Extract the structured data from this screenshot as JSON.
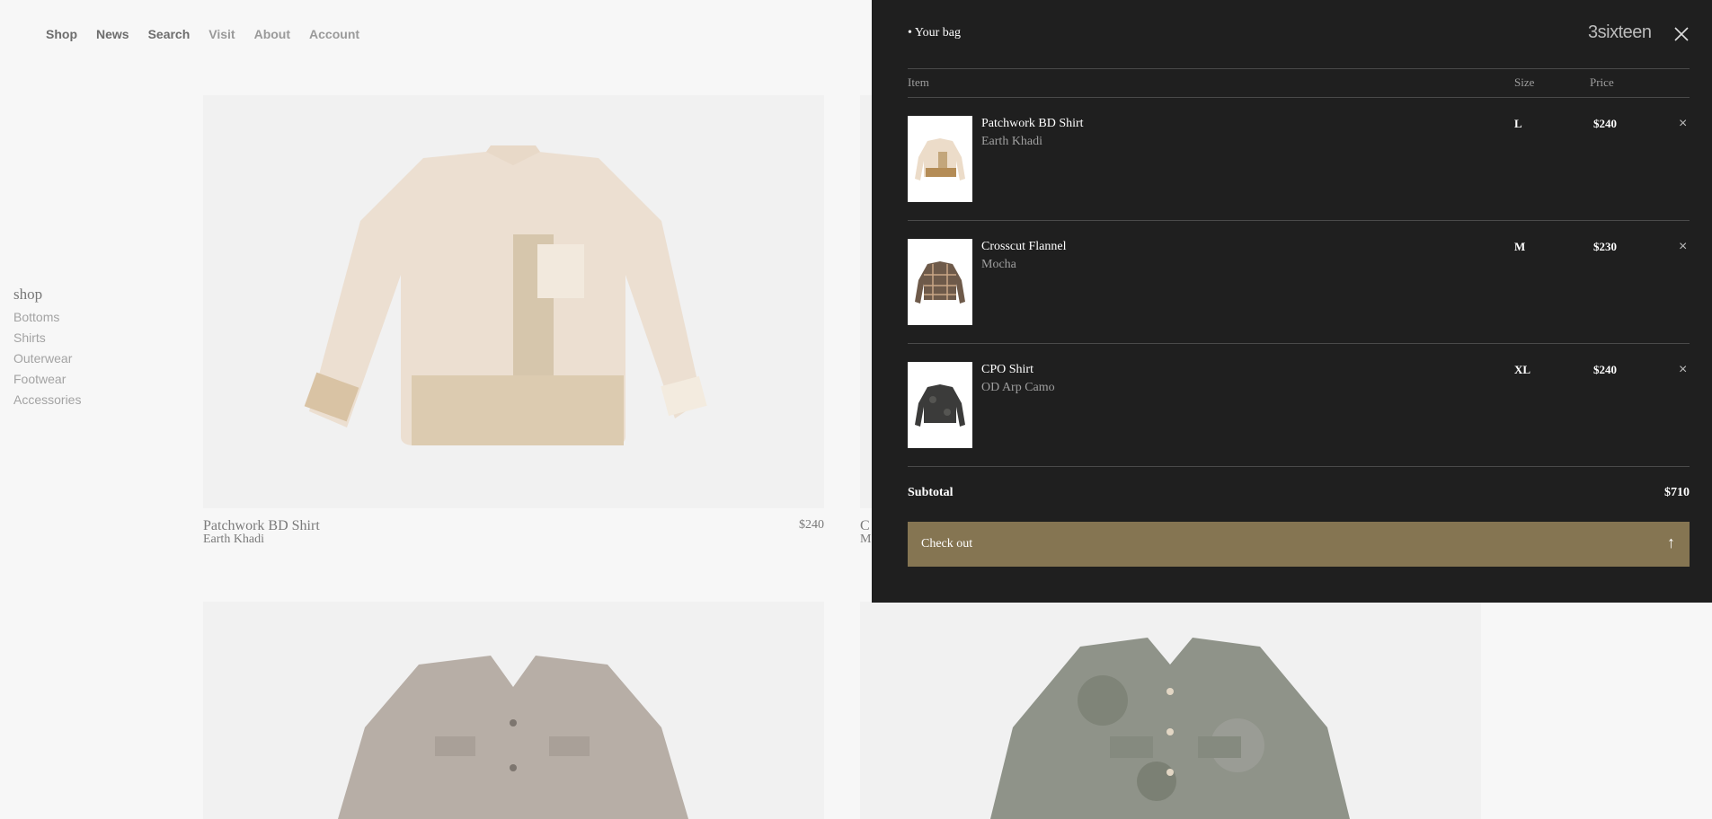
{
  "nav": {
    "items": [
      "Shop",
      "News",
      "Search",
      "Visit",
      "About",
      "Account"
    ]
  },
  "sidebar": {
    "heading": "shop",
    "items": [
      "Bottoms",
      "Shirts",
      "Outerwear",
      "Footwear",
      "Accessories"
    ]
  },
  "products": [
    {
      "name": "Patchwork BD Shirt",
      "variant": "Earth Khadi",
      "price": "$240"
    },
    {
      "name": "C",
      "variant": "M"
    }
  ],
  "bag": {
    "title": "Your bag",
    "brand": "3sixteen",
    "columns": {
      "item": "Item",
      "size": "Size",
      "price": "Price"
    },
    "items": [
      {
        "name": "Patchwork BD Shirt",
        "variant": "Earth Khadi",
        "size": "L",
        "price": "$240"
      },
      {
        "name": "Crosscut Flannel",
        "variant": "Mocha",
        "size": "M",
        "price": "$230"
      },
      {
        "name": "CPO Shirt",
        "variant": "OD Arp Camo",
        "size": "XL",
        "price": "$240"
      }
    ],
    "remove_glyph": "×",
    "subtotal_label": "Subtotal",
    "subtotal": "$710",
    "checkout_label": "Check out",
    "checkout_glyph": "↑"
  },
  "colors": {
    "drawer_bg": "#1f1f1f",
    "checkout_bg": "#857552",
    "page_bg": "#f7f7f7"
  }
}
